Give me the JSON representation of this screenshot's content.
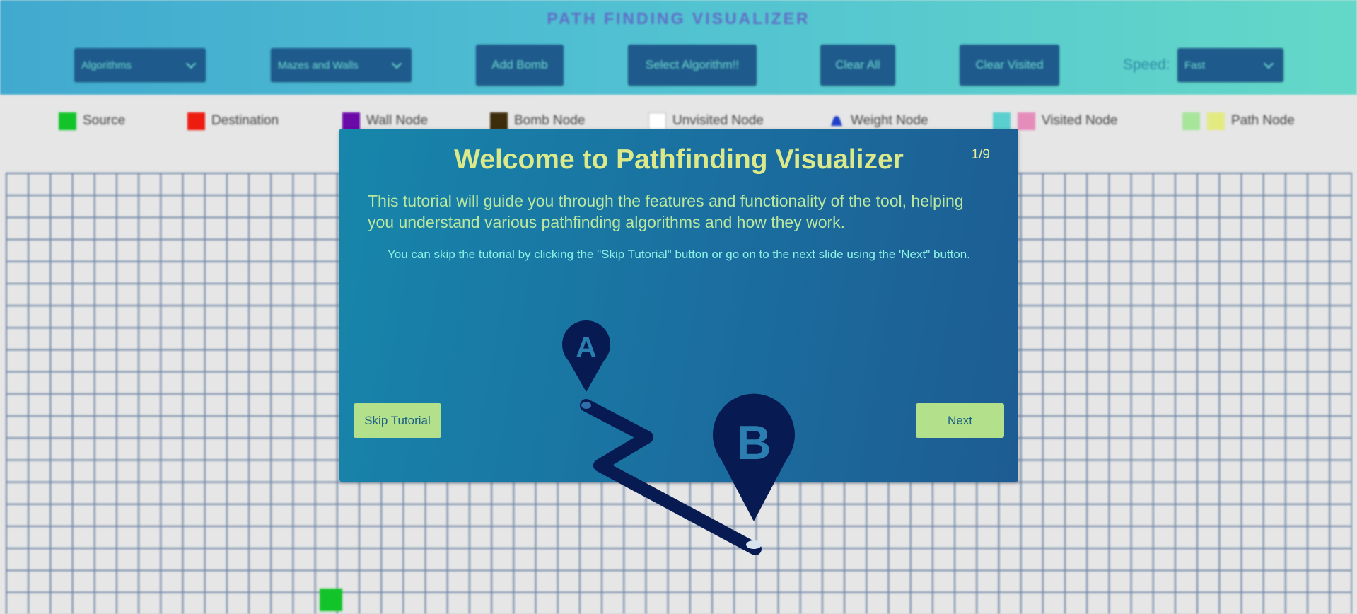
{
  "header": {
    "title": "PATH FINDING VISUALIZER",
    "algorithms_dropdown": "Algorithms",
    "mazes_dropdown": "Mazes and Walls",
    "add_bomb": "Add Bomb",
    "select_algorithm": "Select Algorithm!!",
    "clear_all": "Clear All",
    "clear_visited": "Clear Visited",
    "speed_label": "Speed:",
    "speed_value": "Fast"
  },
  "legend": [
    {
      "label": "Source",
      "colors": [
        "#12c42a"
      ]
    },
    {
      "label": "Destination",
      "colors": [
        "#ee1c10"
      ]
    },
    {
      "label": "Wall Node",
      "colors": [
        "#6a0aa8"
      ]
    },
    {
      "label": "Bomb Node",
      "colors": [
        "#3d2c0c"
      ]
    },
    {
      "label": "Unvisited Node",
      "colors": [
        "#ffffff"
      ]
    },
    {
      "label": "Weight Node",
      "colors": [
        "#2040c8"
      ]
    },
    {
      "label": "Visited Node",
      "colors": [
        "#59cfcf",
        "#e68cbb"
      ]
    },
    {
      "label": "Path Node",
      "colors": [
        "#a7e59b",
        "#e4ea82"
      ]
    }
  ],
  "modal": {
    "title": "Welcome to Pathfinding Visualizer",
    "counter": "1/9",
    "lead": "This tutorial will guide you through the features and functionality of the tool, helping you understand various pathfinding algorithms and how they work.",
    "note": "You can skip the tutorial by clicking the \"Skip Tutorial\" button or go on to the next slide using the 'Next\" button.",
    "skip_label": "Skip Tutorial",
    "next_label": "Next",
    "marker_a": "A",
    "marker_b": "B"
  },
  "colors": {
    "header_gradient_start": "#41a9cf",
    "header_gradient_end": "#64d8c8",
    "button_bg": "#1e5b8c",
    "modal_title": "#dbe98a",
    "modal_button_bg": "#b3e08b",
    "illustration": "#071a52"
  }
}
